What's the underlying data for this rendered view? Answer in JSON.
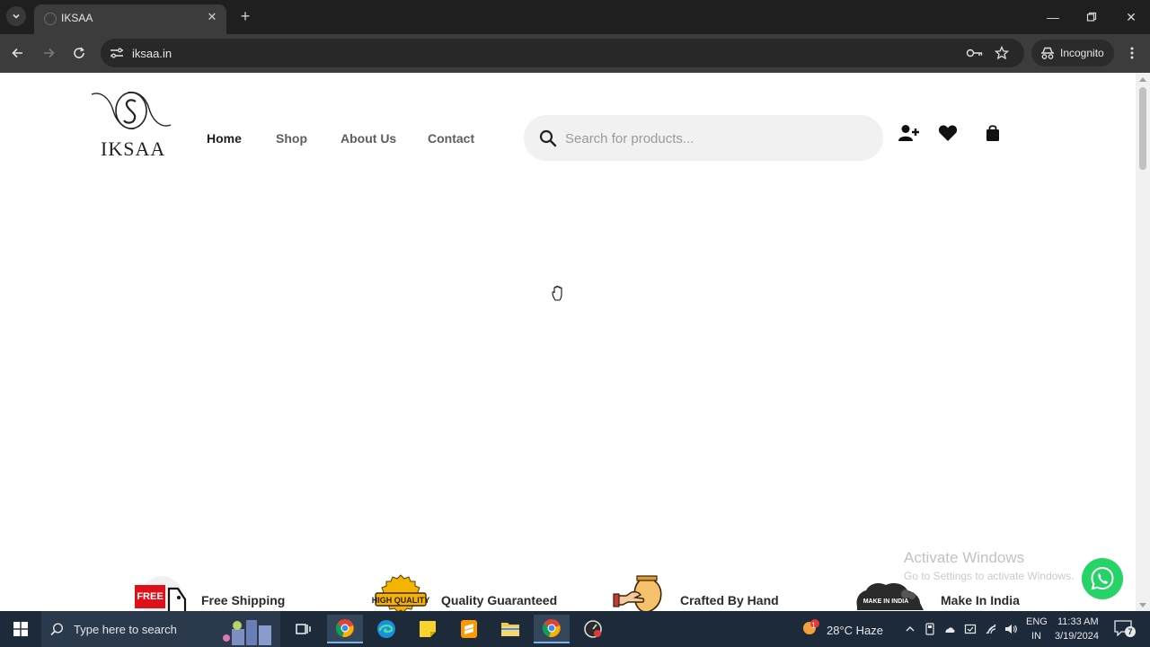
{
  "browser": {
    "tab_title": "IKSAA",
    "url": "iksaa.in",
    "incognito_label": "Incognito"
  },
  "site": {
    "logo_text": "IKSAA",
    "nav": [
      {
        "label": "Home",
        "active": true
      },
      {
        "label": "Shop",
        "active": false
      },
      {
        "label": "About Us",
        "active": false
      },
      {
        "label": "Contact",
        "active": false
      }
    ],
    "search_placeholder": "Search for products...",
    "header_icons": [
      "add-user-icon",
      "heart-icon",
      "shopping-bag-icon"
    ],
    "features": [
      {
        "label": "Free Shipping",
        "icon": "free-shipping-icon",
        "badge": "FREE"
      },
      {
        "label": "Quality Guaranteed",
        "icon": "high-quality-icon",
        "badge": "HIGH QUALITY"
      },
      {
        "label": "Crafted By Hand",
        "icon": "crafted-by-hand-icon"
      },
      {
        "label": "Make In India",
        "icon": "make-in-india-lion-icon",
        "badge": "MAKE IN INDIA"
      }
    ]
  },
  "watermark": {
    "title": "Activate Windows",
    "subtitle": "Go to Settings to activate Windows."
  },
  "taskbar": {
    "search_placeholder": "Type here to search",
    "weather": "28°C  Haze",
    "weather_alert": "1",
    "lang_top": "ENG",
    "lang_bottom": "IN",
    "time": "11:33 AM",
    "date": "3/19/2024",
    "notification_count": "7"
  },
  "colors": {
    "browser_tabbar": "#1f1f1f",
    "browser_toolbar": "#3c3c3c",
    "search_box": "#f1f1f1",
    "whatsapp": "#25d366",
    "taskbar": "#1c2a3a"
  }
}
